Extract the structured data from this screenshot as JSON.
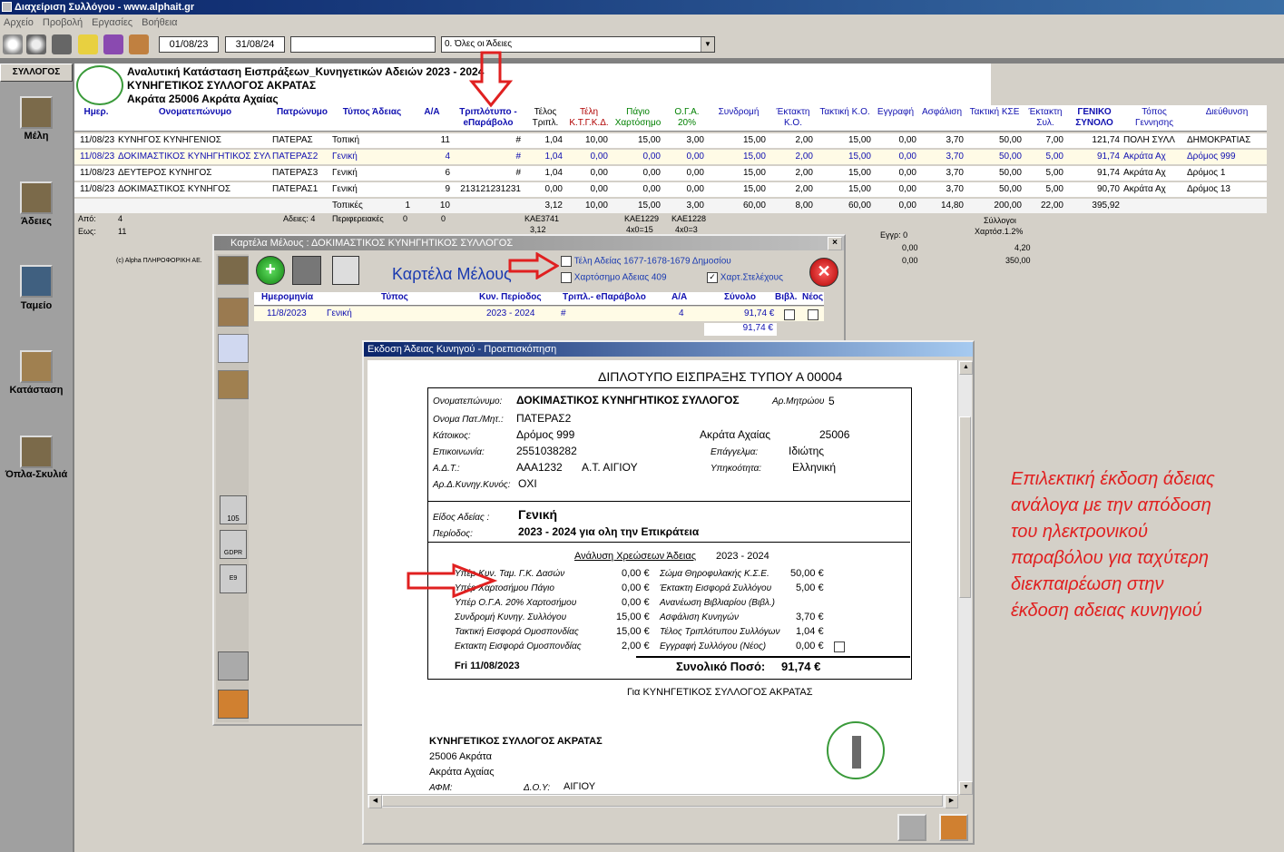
{
  "app": {
    "title": "Διαχείριση Συλλόγου -     www.alphait.gr"
  },
  "menu": [
    "Αρχείο",
    "Προβολή",
    "Εργασίες",
    "Βοήθεια"
  ],
  "toolbar": {
    "date_from": "01/08/23",
    "date_to": "31/08/24",
    "search_value": "",
    "filter_value": "0. Όλες οι Άδειες"
  },
  "sidebar": {
    "header": "ΣΥΛΛΟΓΟΣ",
    "items": [
      {
        "label": "Μέλη",
        "icon": "hunter-icon"
      },
      {
        "label": "Άδειες",
        "icon": "license-icon"
      },
      {
        "label": "Ταμείο",
        "icon": "cash-icon"
      },
      {
        "label": "Κατάσταση",
        "icon": "dog-icon"
      },
      {
        "label": "Όπλα-Σκυλιά",
        "icon": "hunter-dog-icon"
      }
    ]
  },
  "report": {
    "title1": "Αναλυτική Κατάσταση Εισπράξεων_Κυνηγετικών Αδειών 2023 - 2024",
    "title2": "ΚΥΝΗΓΕΤΙΚΟΣ ΣΥΛΛΟΓΟΣ ΑΚΡΑΤΑΣ",
    "title3": "Ακράτα 25006 Ακράτα Αχαίας",
    "columns": [
      "Ημερ.",
      "Ονοματεπώνυμο",
      "Πατρώνυμο",
      "Τύπος Άδειας",
      "Α/Α",
      "Τριπλότυπο - eΠαράβολο",
      "Τέλος Τριπλ.",
      "Τέλη Κ.Τ.Γ.Κ.Δ.",
      "Πάγιο Χαρτόσημο",
      "Ο.Γ.Α. 20%",
      "Συνδρομή",
      "Έκτακτη Κ.Ο.",
      "Τακτική Κ.Ο.",
      "Εγγραφή",
      "Ασφάλιση",
      "Τακτική ΚΣΕ",
      "Έκτακτη Συλ.",
      "ΓΕΝΙΚΟ ΣΥΝΟΛΟ",
      "Τόπος Γεννησης",
      "Διεύθυνση"
    ],
    "rows": [
      [
        "11/08/23",
        "ΚΥΝΗΓΟΣ ΚΥΝΗΓΕΝΙΟΣ",
        "ΠΑΤΕΡΑΣ",
        "Τοπική",
        "11",
        "#",
        "1,04",
        "10,00",
        "15,00",
        "3,00",
        "15,00",
        "2,00",
        "15,00",
        "0,00",
        "3,70",
        "50,00",
        "7,00",
        "121,74",
        "ΠΟΛΗ ΣΥΛΛ",
        "ΔΗΜΟΚΡΑΤΙΑΣ"
      ],
      [
        "11/08/23",
        "ΔΟΚΙΜΑΣΤΙΚΟΣ ΚΥΝΗΓΗΤΙΚΟΣ ΣΥΛ",
        "ΠΑΤΕΡΑΣ2",
        "Γενική",
        "4",
        "#",
        "1,04",
        "0,00",
        "0,00",
        "0,00",
        "15,00",
        "2,00",
        "15,00",
        "0,00",
        "3,70",
        "50,00",
        "5,00",
        "91,74",
        "Ακράτα Αχ",
        "Δρόμος 999"
      ],
      [
        "11/08/23",
        "ΔΕΥΤΕΡΟΣ ΚΥΝΗΓΟΣ",
        "ΠΑΤΕΡΑΣ3",
        "Γενική",
        "6",
        "#",
        "1,04",
        "0,00",
        "0,00",
        "0,00",
        "15,00",
        "2,00",
        "15,00",
        "0,00",
        "3,70",
        "50,00",
        "5,00",
        "91,74",
        "Ακράτα Αχ",
        "Δρόμος 1"
      ],
      [
        "11/08/23",
        "ΔΟΚΙΜΑΣΤΙΚΟΣ ΚΥΝΗΓΟΣ",
        "ΠΑΤΕΡΑΣ1",
        "Γενική",
        "9",
        "213121231231",
        "0,00",
        "0,00",
        "0,00",
        "0,00",
        "15,00",
        "2,00",
        "15,00",
        "0,00",
        "3,70",
        "50,00",
        "5,00",
        "90,70",
        "Ακράτα Αχ",
        "Δρόμος 13"
      ]
    ],
    "totals": {
      "label": "Τοπικές",
      "count": "1",
      "aa": "10",
      "vals": [
        "3,12",
        "10,00",
        "15,00",
        "3,00",
        "60,00",
        "8,00",
        "60,00",
        "0,00",
        "14,80",
        "200,00",
        "22,00",
        "395,92"
      ]
    },
    "footer": {
      "from_label": "Από:",
      "from_val": "4",
      "to_label": "Εως:",
      "to_val": "11",
      "licenses_label": "Αδειες: 4",
      "peripheral_label": "Περιφερειακές",
      "peripheral_val": "0",
      "peripheral_aa": "0",
      "kae1": "ΚΑΕ3741",
      "kae1_val": "3,12",
      "kae2": "ΚΑΕ1229",
      "kae2_val": "4x0=15",
      "kae3": "ΚΑΕ1228",
      "kae3_val": "4x0=3",
      "eggr": "Εγγρ: 0",
      "z1": "0,00",
      "z2": "0,00",
      "syllogoi": "Σύλλογοι",
      "xartosimo": "Χαρτόσ.1.2%",
      "v1": "4,20",
      "v2": "350,00",
      "copyright": "(c) Alpha ΠΛΗΡΟΦΟΡΙΚΗ ΑΕ."
    }
  },
  "member_window": {
    "title": "Καρτέλα Μέλους : ΔΟΚΙΜΑΣΤΙΚΟΣ ΚΥΝΗΓΗΤΙΚΟΣ ΣΥΛΛΟΓΟΣ",
    "heading": "Καρτέλα Μέλους",
    "check1": "Τέλη Αδείας 1677-1678-1679 Δημοσίου",
    "check2": "Χαρτόσημο Αδειας 409",
    "check3": "Χαρτ.Στελέχους",
    "columns": [
      "Ημερομηνία",
      "Τύπος",
      "Κυν. Περίοδος",
      "Τριπλ.- eΠαράβολο",
      "Α/Α",
      "Σύνολο",
      "Βιβλ.",
      "Νέος"
    ],
    "row": {
      "date": "11/8/2023",
      "type": "Γενική",
      "period": "2023 - 2024",
      "tripl": "#",
      "aa": "4",
      "total": "91,74 €"
    },
    "sum": "91,74 €"
  },
  "preview_window": {
    "title": "Εκδοση Άδειας Κυνηγού - Προεπισκόπηση",
    "doc_title": "ΔΙΠΛΟΤΥΠΟ ΕΙΣΠΡΑΞΗΣ ΤΥΠΟΥ Α  00004",
    "name_label": "Ονοματεπώνυμο:",
    "name": "ΔΟΚΙΜΑΣΤΙΚΟΣ ΚΥΝΗΓΗΤΙΚΟΣ ΣΥΛΛΟΓΟΣ",
    "mitroo_label": "Αρ.Μητρώου",
    "mitroo": "5",
    "father_label": "Ονομα Πατ./Μητ.:",
    "father": "ΠΑΤΕΡΑΣ2",
    "resident_label": "Κάτοικος:",
    "street": "Δρόμος 999",
    "city": "Ακράτα Αχαίας",
    "zip": "25006",
    "phone_label": "Επικοινωνία:",
    "phone": "2551038282",
    "job_label": "Επάγγελμα:",
    "job": "Ιδιώτης",
    "adt_label": "Α.Δ.Τ.:",
    "adt": "ΑΑΑ1232",
    "adt_office": "Α.Τ. ΑΙΓΙΟΥ",
    "nation_label": "Υπηκοότητα:",
    "nation": "Ελληνική",
    "gun_label": "Αρ.Δ.Κυνηγ.Κυνός:",
    "gun": "ΟΧΙ",
    "kind_label": "Είδος Αδείας :",
    "kind": "Γενική",
    "period_label": "Περίοδος:",
    "period": "2023 - 2024 για ολη την Επικράτεια",
    "charges_title": "Ανάλυση Χρεώσεων Άδειας",
    "charges_period": "2023 - 2024",
    "charges_left": [
      {
        "label": "Υπέρ Κυν. Ταμ. Γ.Κ. Δασών",
        "value": "0,00 €"
      },
      {
        "label": "Υπέρ Χαρτοσήμου Πάγιο",
        "value": "0,00 €"
      },
      {
        "label": "Υπέρ Ο.Γ.Α. 20% Χαρτοσήμου",
        "value": "0,00 €"
      },
      {
        "label": "Συνδρομή Κυνηγ. Συλλόγου",
        "value": "15,00 €"
      },
      {
        "label": "Τακτική Εισφορά Ομοσπονδίας",
        "value": "15,00 €"
      },
      {
        "label": "Εκτακτη Εισφορά Ομοσπονδίας",
        "value": "2,00 €"
      }
    ],
    "charges_right": [
      {
        "label": "Σώμα Θηροφυλακής Κ.Σ.Ε.",
        "value": "50,00 €"
      },
      {
        "label": "Έκτακτη Εισφορά Συλλόγου",
        "value": "5,00 €"
      },
      {
        "label": "Ανανέωση Βιβλιαρίου (Βιβλ.)",
        "value": ""
      },
      {
        "label": "Ασφάλιση Κυνηγών",
        "value": "3,70 €"
      },
      {
        "label": "Τέλος Τριπλότυπου Συλλόγων",
        "value": "1,04 €"
      },
      {
        "label": "Εγγραφή Συλλόγου  (Νέος)",
        "value": "0,00 €"
      }
    ],
    "date": "Fri 11/08/2023",
    "total_label": "Συνολικό Ποσό:",
    "total": "91,74 €",
    "for_club": "Για ΚΥΝΗΓΕΤΙΚΟΣ ΣΥΛΛΟΓΟΣ ΑΚΡΑΤΑΣ",
    "club_name": "ΚΥΝΗΓΕΤΙΚΟΣ ΣΥΛΛΟΓΟΣ ΑΚΡΑΤΑΣ",
    "club_addr1": "25006 Ακράτα",
    "club_addr2": "Ακράτα Αχαίας",
    "afm_label": "ΑΦΜ:",
    "doy_label": "Δ.Ο.Υ:",
    "doy": "ΑΙΓΙΟΥ"
  },
  "annotation": [
    "Επιλεκτική έκδοση άδειας",
    "ανάλογα με την απόδοση",
    "του ηλεκτρονικού",
    "παραβόλου για ταχύτερη",
    "διεκπαιρέωση στην",
    "έκδοση αδειας κυνηγιού"
  ],
  "colors": {
    "accent": "#0a246a",
    "annotation": "#e02020",
    "selected_text": "#1010b0"
  }
}
